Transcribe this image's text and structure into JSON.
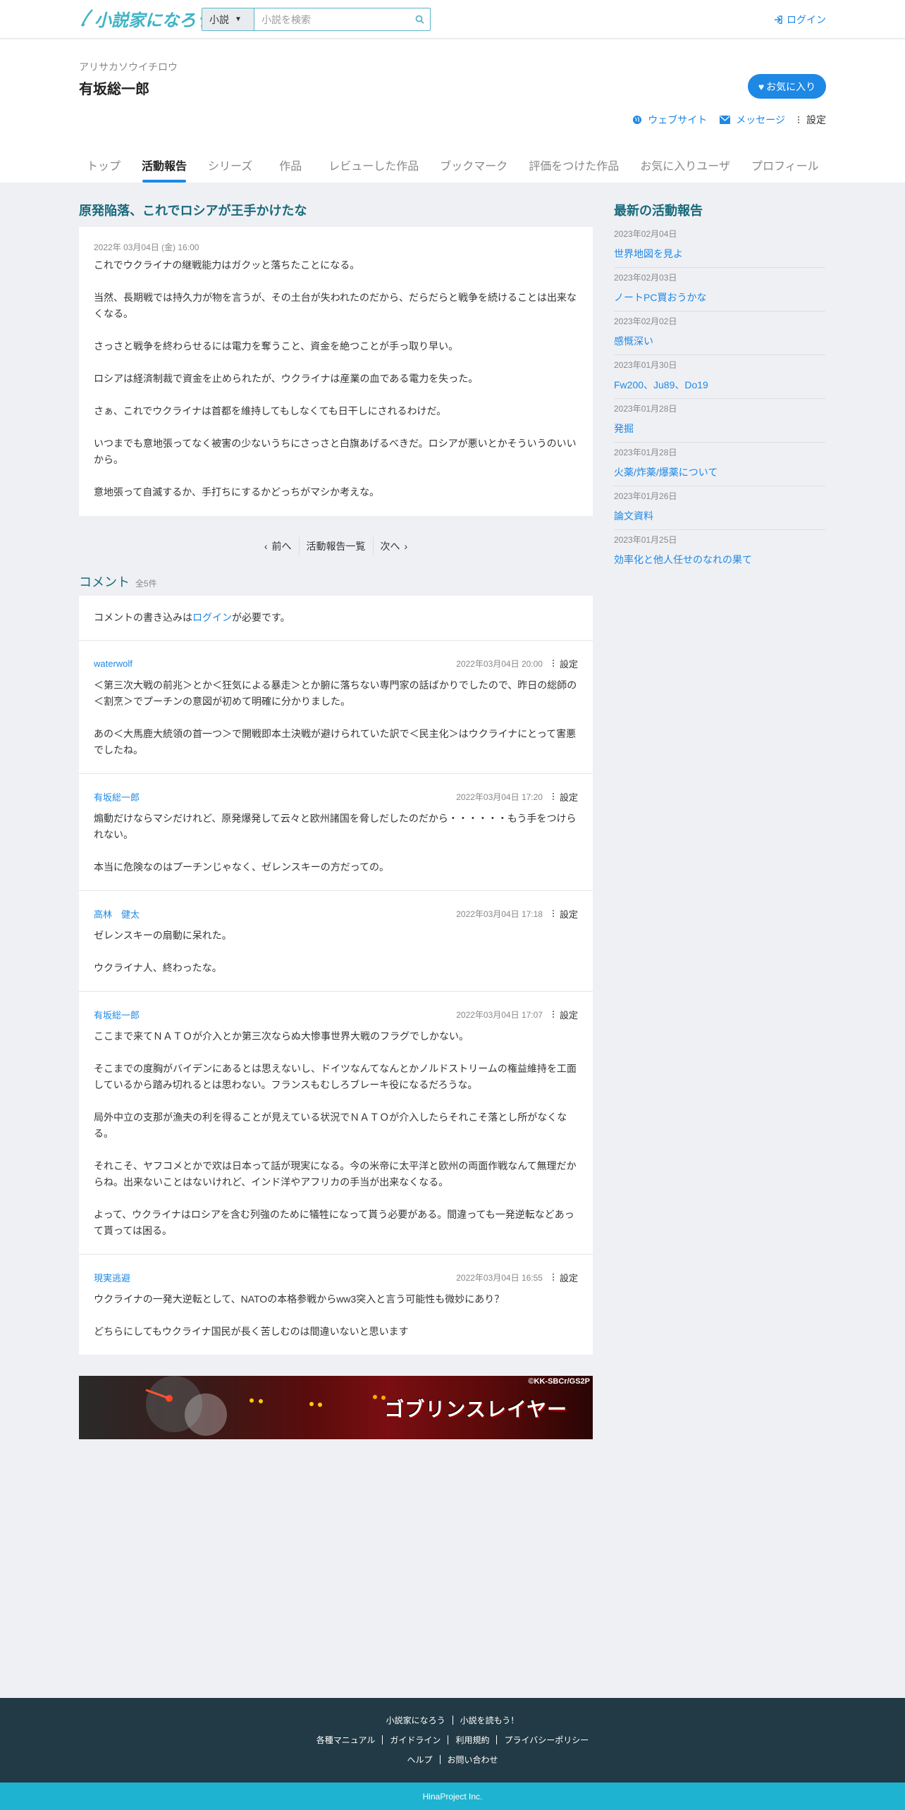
{
  "header": {
    "logo_text": "小説家になろう",
    "search_category": "小説",
    "search_placeholder": "小説を検索",
    "login_label": "ログイン"
  },
  "profile": {
    "kana": "アリサカソウイチロウ",
    "name": "有坂総一郎",
    "favorite_label": "お気に入り",
    "website_label": "ウェブサイト",
    "message_label": "メッセージ",
    "settings_label": "設定",
    "tabs": [
      "トップ",
      "活動報告",
      "シリーズ",
      "作品",
      "レビューした作品",
      "ブックマーク",
      "評価をつけた作品",
      "お気に入りユーザ",
      "プロフィール"
    ]
  },
  "report": {
    "title_first": "原",
    "title_rest": "発陥落、これでロシアが王手かけたな",
    "date": "2022年 03月04日 (金) 16:00",
    "paragraphs": [
      "これでウクライナの継戦能力はガクッと落ちたことになる。",
      "当然、長期戦では持久力が物を言うが、その土台が失われたのだから、だらだらと戦争を続けることは出来なくなる。",
      "さっさと戦争を終わらせるには電力を奪うこと、資金を絶つことが手っ取り早い。",
      "ロシアは経済制裁で資金を止められたが、ウクライナは産業の血である電力を失った。",
      "さぁ、これでウクライナは首都を維持してもしなくても日干しにされるわけだ。",
      "いつまでも意地張ってなく被害の少ないうちにさっさと白旗あげるべきだ。ロシアが悪いとかそういうのいいから。",
      "意地張って自滅するか、手打ちにするかどっちがマシか考えな。"
    ]
  },
  "pager": {
    "prev": "前へ",
    "list": "活動報告一覧",
    "next": "次へ"
  },
  "comments": {
    "title": "コメント",
    "count": "全5件",
    "notice_before": "コメントの書き込みは",
    "notice_link": "ログイン",
    "notice_after": "が必要です。",
    "settings_label": "設定",
    "items": [
      {
        "name": "waterwolf",
        "date": "2022年03月04日 20:00",
        "paragraphs": [
          "＜第三次大戦の前兆＞とか＜狂気による暴走＞とか腑に落ちない専門家の話ばかりでしたので、昨日の総師の＜割烹＞でプーチンの意図が初めて明確に分かりました。",
          "あの＜大馬鹿大統領の首一つ＞で開戦即本土決戦が避けられていた訳で＜民主化＞はウクライナにとって害悪でしたね。"
        ]
      },
      {
        "name": "有坂総一郎",
        "date": "2022年03月04日 17:20",
        "paragraphs": [
          "煽動だけならマシだけれど、原発爆発して云々と欧州諸国を脅しだしたのだから・・・・・・もう手をつけられない。",
          "本当に危険なのはプーチンじゃなく、ゼレンスキーの方だっての。"
        ]
      },
      {
        "name": "高林　健太",
        "date": "2022年03月04日 17:18",
        "paragraphs": [
          "ゼレンスキーの扇動に呆れた。",
          "ウクライナ人、終わったな。"
        ]
      },
      {
        "name": "有坂総一郎",
        "date": "2022年03月04日 17:07",
        "paragraphs": [
          "ここまで来てＮＡＴＯが介入とか第三次ならぬ大惨事世界大戦のフラグでしかない。",
          "そこまでの度胸がバイデンにあるとは思えないし、ドイツなんてなんとかノルドストリームの権益維持を工面しているから踏み切れるとは思わない。フランスもむしろブレーキ役になるだろうな。",
          "局外中立の支那が漁夫の利を得ることが見えている状況でＮＡＴＯが介入したらそれこそ落とし所がなくなる。",
          "それこそ、ヤフコメとかで欢は日本って話が現実になる。今の米帝に太平洋と欧州の両面作戦なんて無理だからね。出来ないことはないけれど、インド洋やアフリカの手当が出来なくなる。",
          "よって、ウクライナはロシアを含む列強のために犠牲になって貰う必要がある。間違っても一発逆転などあって貰っては困る。"
        ]
      },
      {
        "name": "現実逃避",
        "date": "2022年03月04日 16:55",
        "paragraphs": [
          "ウクライナの一発大逆転として、NATOの本格参戦からww3突入と言う可能性も微妙にあり？",
          "どちらにしてもウクライナ国民が長く苦しむのは間違いないと思います"
        ]
      }
    ]
  },
  "banner": {
    "credit": "©KK-SBCr/GS2P",
    "title": "ゴブリンスレイヤー"
  },
  "sidebar": {
    "title_first": "最",
    "title_rest": "新の活動報告",
    "items": [
      {
        "date": "2023年02月04日",
        "label": "世界地図を見よ"
      },
      {
        "date": "2023年02月03日",
        "label": "ノートPC買おうかな"
      },
      {
        "date": "2023年02月02日",
        "label": "感慨深い"
      },
      {
        "date": "2023年01月30日",
        "label": "Fw200、Ju89、Do19"
      },
      {
        "date": "2023年01月28日",
        "label": "発掘"
      },
      {
        "date": "2023年01月28日",
        "label": "火薬/炸薬/爆薬について"
      },
      {
        "date": "2023年01月26日",
        "label": "論文資料"
      },
      {
        "date": "2023年01月25日",
        "label": "効率化と他人任せのなれの果て"
      }
    ]
  },
  "footer": {
    "row1": [
      "小説家になろう",
      "小説を読もう！"
    ],
    "row2": [
      "各種マニュアル",
      "ガイドライン",
      "利用規約",
      "プライバシーポリシー"
    ],
    "row3": [
      "ヘルプ",
      "お問い合わせ"
    ],
    "copyright": "HinaProject Inc."
  },
  "colors": {
    "accent": "#1e88e5",
    "heading": "#1a6a7c",
    "footer_bg": "#213a45",
    "copyright_bg": "#1eb3d0",
    "page_bg": "#eff0f4"
  }
}
